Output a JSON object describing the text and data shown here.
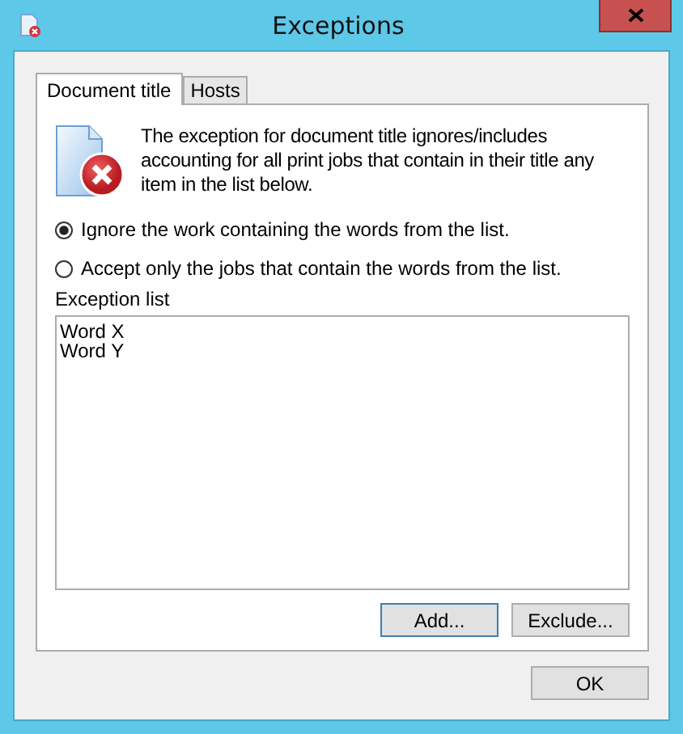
{
  "window": {
    "title": "Exceptions"
  },
  "tabs": [
    {
      "label": "Document title",
      "selected": true
    },
    {
      "label": "Hosts",
      "selected": false
    }
  ],
  "description": "The exception for document title ignores/includes accounting for all print jobs that contain in their title any item in the list below.",
  "options": [
    {
      "label": "Ignore the work containing the words from the list.",
      "selected": true
    },
    {
      "label": "Accept only the jobs that contain the words from the list.",
      "selected": false
    }
  ],
  "exception_list": {
    "label": "Exception list",
    "items": [
      "Word X",
      "Word Y"
    ]
  },
  "list_buttons": [
    "Add...",
    "Exclude..."
  ],
  "ok_button": "OK"
}
